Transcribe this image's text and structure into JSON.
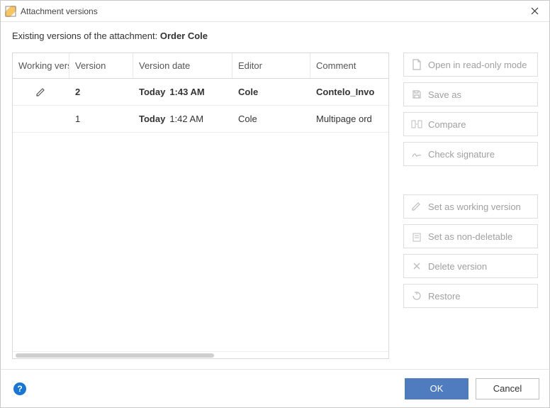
{
  "window": {
    "title": "Attachment versions"
  },
  "description": {
    "prefix": "Existing versions of the attachment: ",
    "name": "Order Cole"
  },
  "table": {
    "headers": {
      "working_version": "Working version",
      "version": "Version",
      "version_date": "Version date",
      "editor": "Editor",
      "comment": "Comment"
    },
    "rows": [
      {
        "working": true,
        "version": "2",
        "date_prefix": "Today",
        "date_time": "1:43 AM",
        "editor": "Cole",
        "comment": "Contelo_Invo",
        "bold": true
      },
      {
        "working": false,
        "version": "1",
        "date_prefix": "Today",
        "date_time": "1:42 AM",
        "editor": "Cole",
        "comment": "Multipage ord",
        "bold": false
      }
    ]
  },
  "actions": {
    "open_readonly": "Open in read-only mode",
    "save_as": "Save as",
    "compare": "Compare",
    "check_signature": "Check signature",
    "set_working": "Set as working version",
    "set_nondeletable": "Set as non-deletable",
    "delete_version": "Delete version",
    "restore": "Restore"
  },
  "footer": {
    "ok": "OK",
    "cancel": "Cancel"
  }
}
